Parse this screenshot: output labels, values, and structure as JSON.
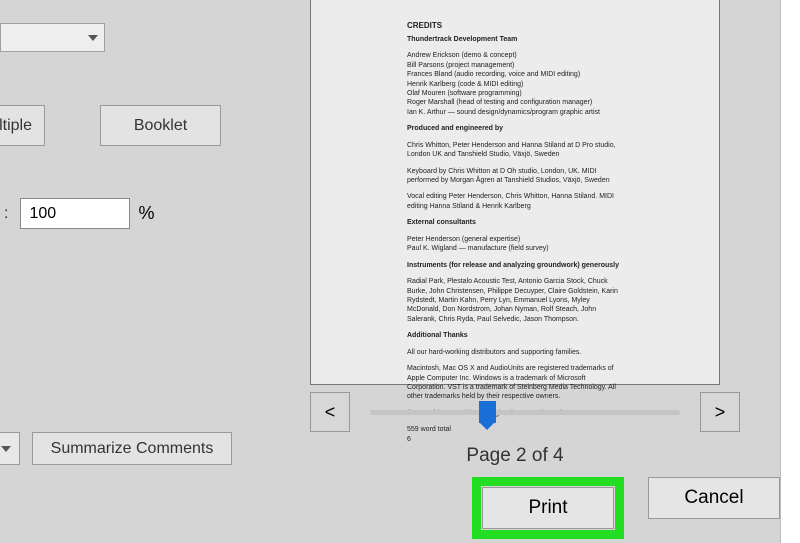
{
  "layout": {
    "multiple_label": "ultiple",
    "booklet_label": "Booklet"
  },
  "scale": {
    "label_suffix": ":",
    "value": "100",
    "unit": "%"
  },
  "comments": {
    "summarize_label": "Summarize Comments"
  },
  "preview": {
    "title": "CREDITS",
    "sections": [
      "Thundertrack Development Team",
      "Andrew Erickson (demo & concept)\nBill Parsons (project management)\nFrances Bland (audio recording, voice and MIDI editing)\nHenrik Karlberg (code & MIDI editing)\nOlaf Mouren (software programming)\nRoger Marshall (head of testing and configuration manager)\nIan K. Arthur — sound design/dynamics/program graphic artist",
      "Produced and engineered by",
      "Chris Whitton, Peter Henderson and Hanna Stiland at D Pro studio, London UK and Tanshield Studio, Växjö, Sweden",
      "Keyboard by Chris Whitton at D Oh studio, London, UK. MIDI performed by Morgan Ågren at Tanshield Studios, Växjö, Sweden",
      "Vocal editing Peter Henderson, Chris Whitton, Hanna Stiland. MIDI editing Hanna Stiland & Henrik Karlberg",
      "External consultants",
      "Peter Henderson (general expertise)\nPaul K. Wigland — manufacture (field survey)",
      "Instruments (for release and analyzing groundwork) generously",
      "Radial Park, Plestalo Acoustic Test, Antonio Garcia Stock, Chuck Burke, John Christensen, Philippe Decuyper, Claire Goldstein, Karin Rydstedt, Martin Kahn, Perry Lyn, Emmanuel Lyons, Myley McDonald, Don Nordstrom, Johan Nyman, Rolf Steach, John Salerank, Chris Ryda, Paul Selvedic, Jason Thompson.",
      "Additional Thanks",
      "All our hard-working distributors and supporting families.",
      "Macintosh, Mac OS X and AudioUnits are registered trademarks of Apple Computer Inc. Windows is a trademark of Microsoft Corporation. VST is a trademark of Steinberg Media Technology. All other trademarks held by their respective owners.",
      "©2006 This manual is copyrighted Toontrack Music AB.",
      "559 word total\n6"
    ]
  },
  "pager": {
    "prev": "<",
    "next": ">",
    "indicator": "Page 2 of 4"
  },
  "footer": {
    "print": "Print",
    "cancel": "Cancel"
  }
}
